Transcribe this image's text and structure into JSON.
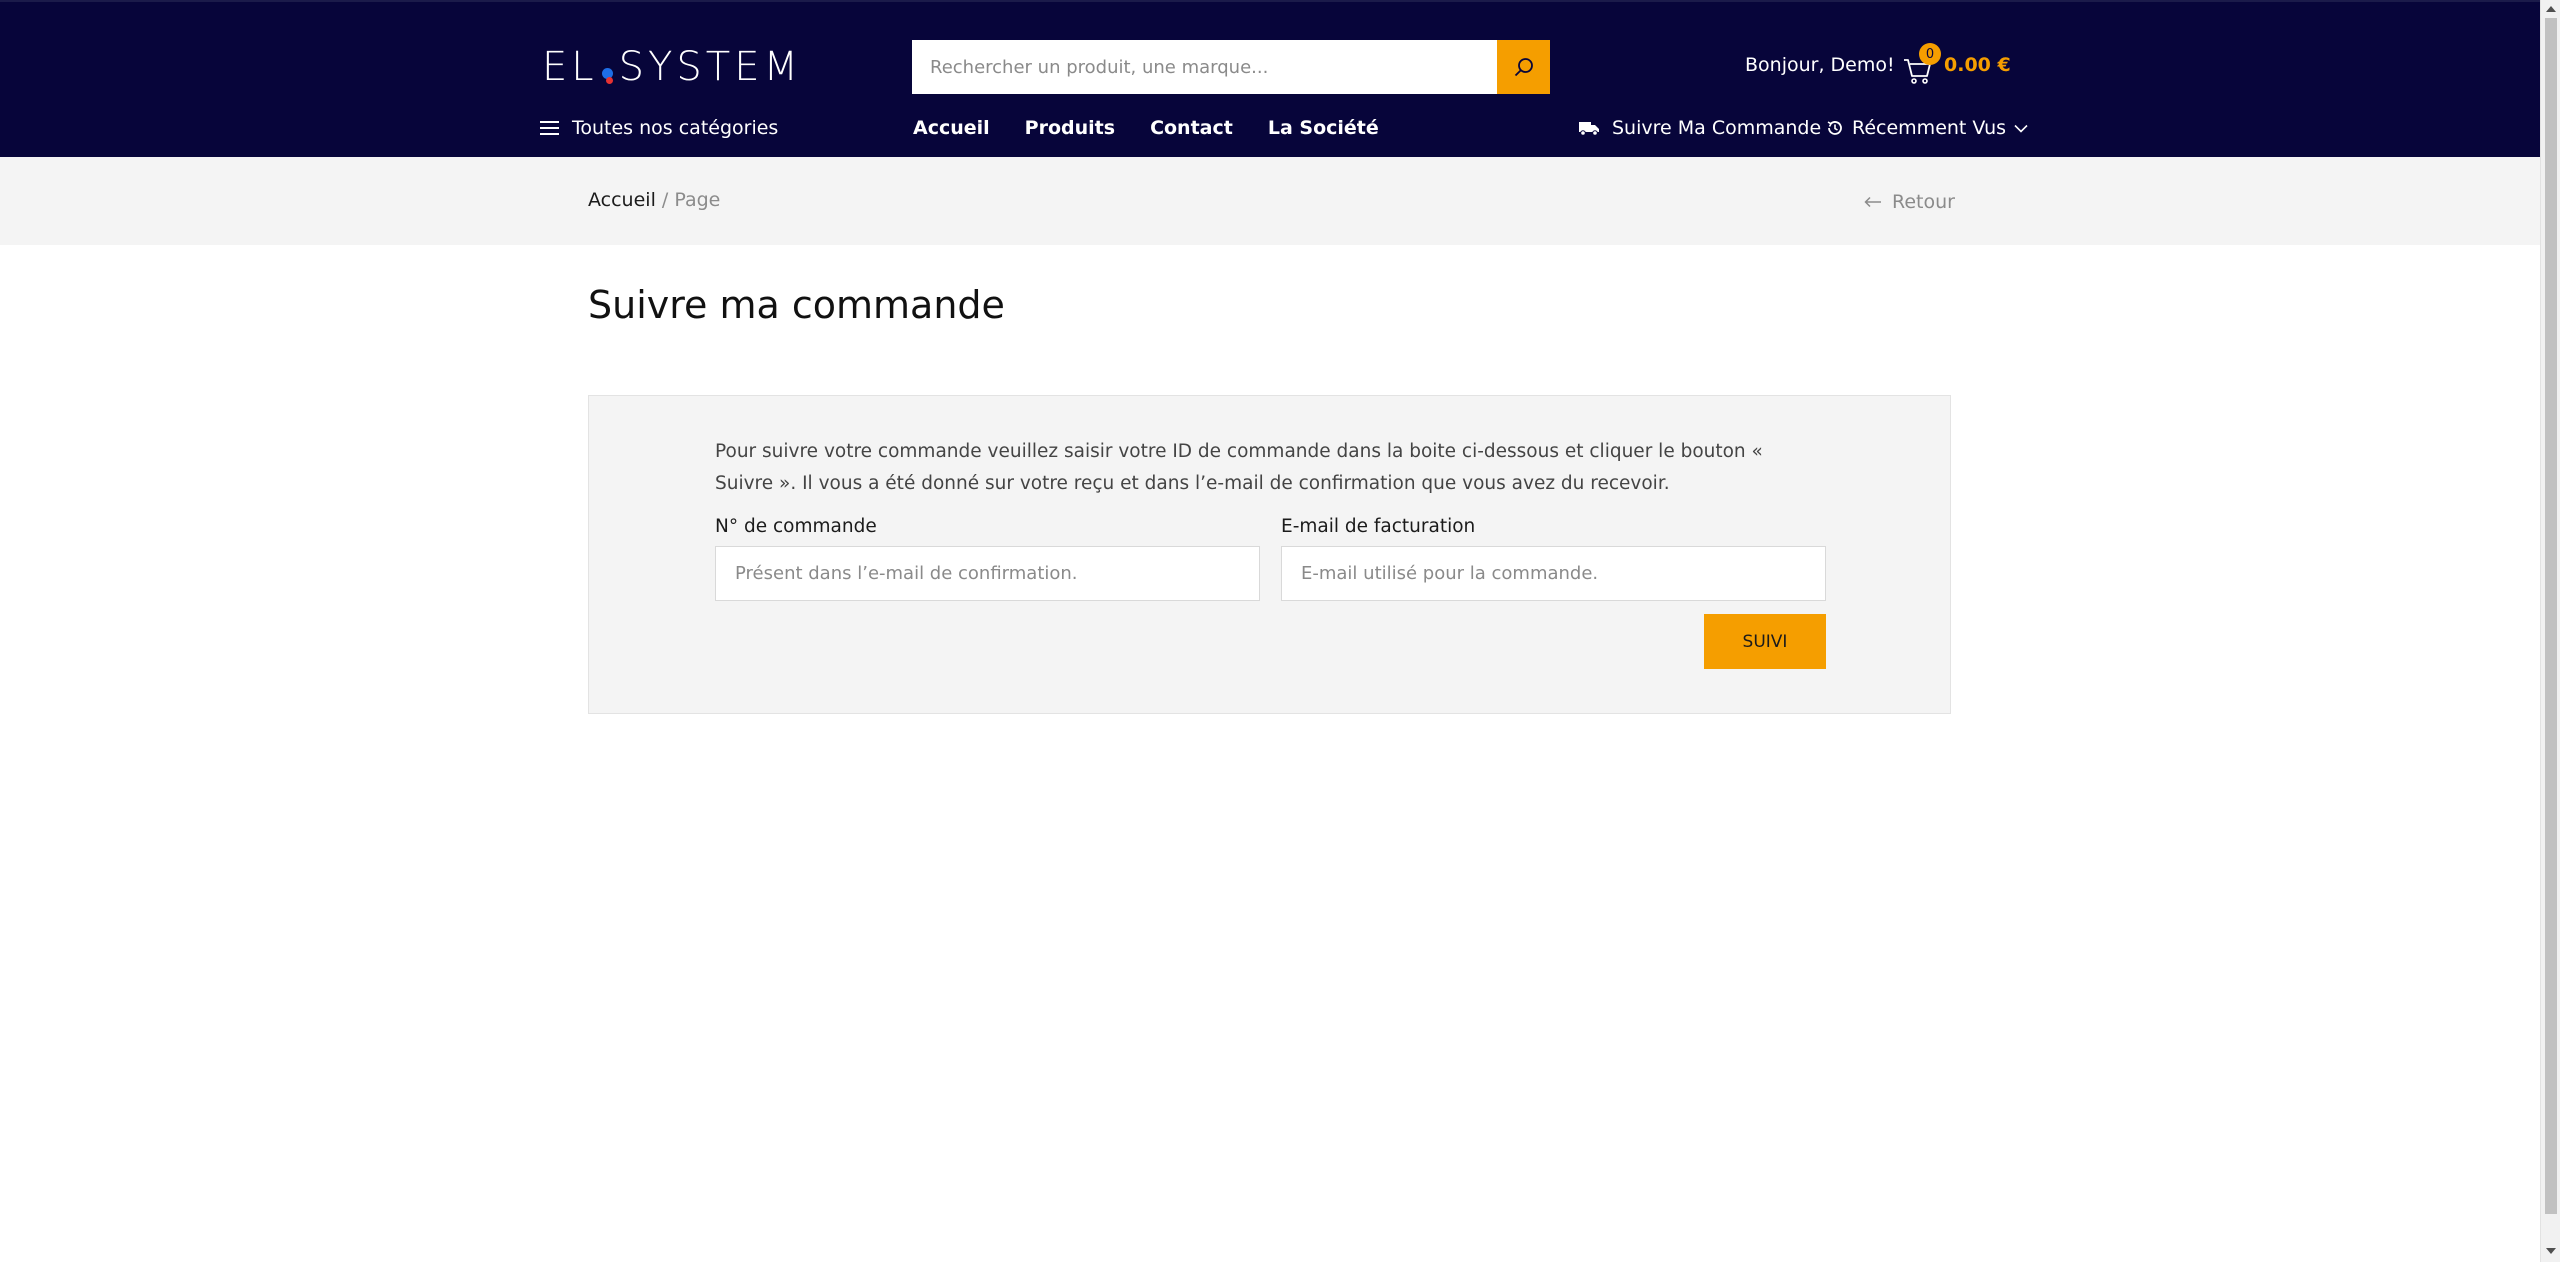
{
  "header": {
    "logo_text_left": "EL",
    "logo_text_right": "SYSTEM",
    "search_placeholder": "Rechercher un produit, une marque...",
    "greeting": "Bonjour, Demo!",
    "cart_count": "0",
    "cart_total": "0.00 €",
    "categories_label": "Toutes nos catégories",
    "nav": [
      "Accueil",
      "Produits",
      "Contact",
      "La Société"
    ],
    "track_order": "Suivre Ma Commande",
    "recently_viewed": "Récemment Vus"
  },
  "breadcrumb": {
    "home": "Accueil",
    "separator": "/",
    "current": "Page",
    "back": "Retour"
  },
  "main": {
    "title": "Suivre ma commande",
    "intro": "Pour suivre votre commande veuillez saisir votre ID de commande dans la boite ci-dessous et cliquer le bouton « Suivre ». Il vous a été donné sur votre reçu et dans l’e-mail de confirmation que vous avez du recevoir.",
    "order_label": "N° de commande",
    "order_placeholder": "Présent dans l’e-mail de confirmation.",
    "email_label": "E-mail de facturation",
    "email_placeholder": "E-mail utilisé pour la commande.",
    "submit_label": "SUIVI"
  },
  "icons": {
    "search": "search-icon",
    "cart": "cart-icon",
    "menu": "hamburger-icon",
    "truck": "truck-icon",
    "history": "history-icon",
    "chevron": "chevron-down-icon",
    "back_arrow": "arrow-left-icon"
  },
  "colors": {
    "header_bg": "#07053a",
    "accent": "#f59e00",
    "panel_bg": "#f4f4f4"
  }
}
